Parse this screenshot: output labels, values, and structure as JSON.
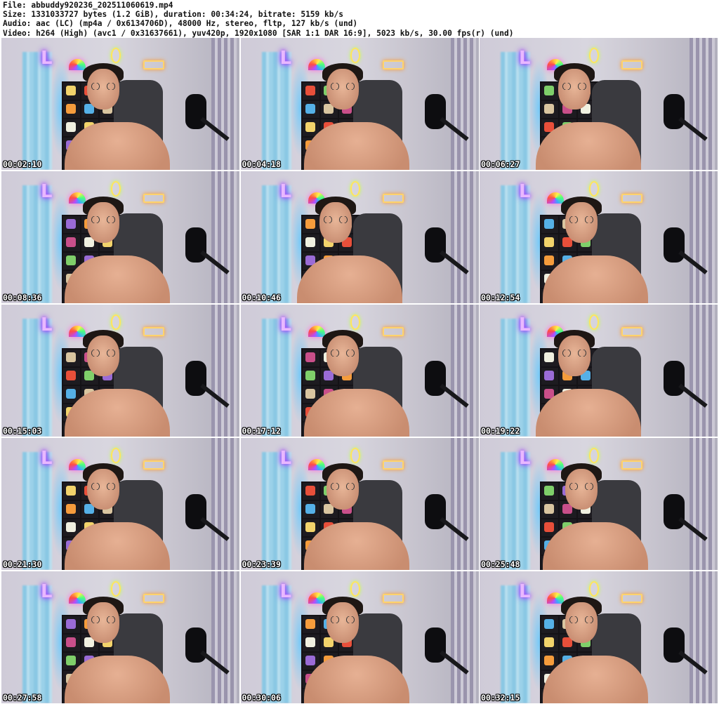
{
  "header": {
    "file_line": "File: abbuddy920236_202511060619.mp4",
    "size_line": "Size: 1331033727 bytes (1.2 GiB), duration: 00:34:24, bitrate: 5159 kb/s",
    "audio_line": "Audio: aac (LC) (mp4a / 0x6134706D), 48000 Hz, stereo, fltp, 127 kb/s (und)",
    "video_line": "Video: h264 (High) (avc1 / 0x31637661), yuv420p, 1920x1080 [SAR 1:1 DAR 16:9], 5023 kb/s, 30.00 fps(r) (und)"
  },
  "thumbnails": [
    {
      "timestamp": "00:02:10"
    },
    {
      "timestamp": "00:04:18"
    },
    {
      "timestamp": "00:06:27"
    },
    {
      "timestamp": "00:08:36"
    },
    {
      "timestamp": "00:10:46"
    },
    {
      "timestamp": "00:12:54"
    },
    {
      "timestamp": "00:15:03"
    },
    {
      "timestamp": "00:17:12"
    },
    {
      "timestamp": "00:19:22"
    },
    {
      "timestamp": "00:21:30"
    },
    {
      "timestamp": "00:23:39"
    },
    {
      "timestamp": "00:25:48"
    },
    {
      "timestamp": "00:27:58"
    },
    {
      "timestamp": "00:30:06"
    },
    {
      "timestamp": "00:32:15"
    }
  ]
}
